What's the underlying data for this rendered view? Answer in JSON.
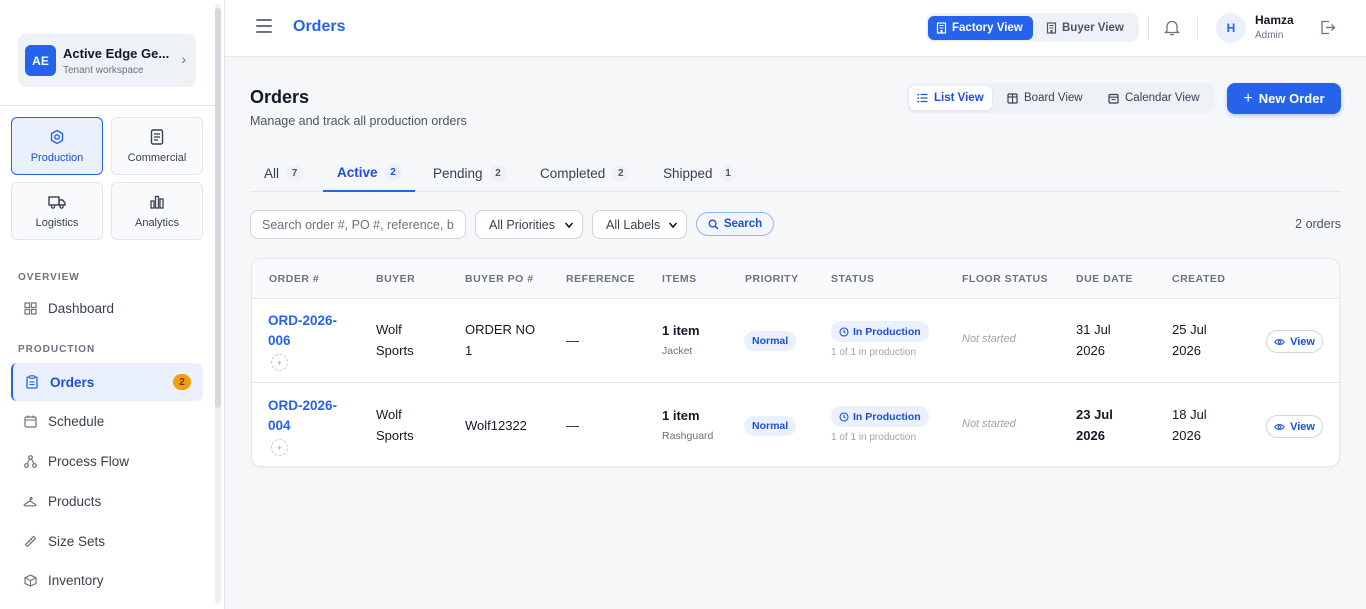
{
  "tenant": {
    "initials": "AE",
    "name": "Active Edge Ge...",
    "subtitle": "Tenant workspace"
  },
  "modules": [
    {
      "label": "Production",
      "icon": "hexagon-icon"
    },
    {
      "label": "Commercial",
      "icon": "document-icon"
    },
    {
      "label": "Logistics",
      "icon": "truck-icon"
    },
    {
      "label": "Analytics",
      "icon": "bar-chart-icon"
    }
  ],
  "sidebar": {
    "overview_label": "OVERVIEW",
    "production_label": "PRODUCTION",
    "items": [
      {
        "label": "Dashboard",
        "icon": "grid-icon"
      },
      {
        "label": "Orders",
        "icon": "clipboard-icon",
        "badge": "2"
      },
      {
        "label": "Schedule",
        "icon": "calendar-icon"
      },
      {
        "label": "Process Flow",
        "icon": "flow-icon"
      },
      {
        "label": "Products",
        "icon": "hanger-icon"
      },
      {
        "label": "Size Sets",
        "icon": "ruler-icon"
      },
      {
        "label": "Inventory",
        "icon": "box-icon"
      }
    ]
  },
  "topbar": {
    "title": "Orders",
    "factory_view": "Factory View",
    "buyer_view": "Buyer View",
    "user_initial": "H",
    "user_name": "Hamza",
    "user_role": "Admin"
  },
  "page": {
    "title": "Orders",
    "subtitle": "Manage and track all production orders",
    "list_view": "List View",
    "board_view": "Board View",
    "calendar_view": "Calendar View",
    "new_order": "New Order"
  },
  "tabs": [
    {
      "label": "All",
      "count": "7"
    },
    {
      "label": "Active",
      "count": "2"
    },
    {
      "label": "Pending",
      "count": "2"
    },
    {
      "label": "Completed",
      "count": "2"
    },
    {
      "label": "Shipped",
      "count": "1"
    }
  ],
  "filters": {
    "search_placeholder": "Search order #, PO #, reference, buyer...",
    "priority": "All Priorities",
    "labels": "All Labels",
    "search_button": "Search",
    "result_count": "2 orders"
  },
  "table": {
    "headers": [
      "ORDER #",
      "BUYER",
      "BUYER PO #",
      "REFERENCE",
      "ITEMS",
      "PRIORITY",
      "STATUS",
      "FLOOR STATUS",
      "DUE DATE",
      "CREATED"
    ],
    "rows": [
      {
        "order": "ORD-2026-006",
        "buyer": "Wolf Sports",
        "po": "ORDER NO 1",
        "reference": "—",
        "items": "1 item",
        "item_type": "Jacket",
        "priority": "Normal",
        "status": "In Production",
        "status_sub": "1 of 1 in production",
        "floor": "Not started",
        "due": "31 Jul 2026",
        "created": "25 Jul 2026",
        "action": "View"
      },
      {
        "order": "ORD-2026-004",
        "buyer": "Wolf Sports",
        "po": "Wolf12322",
        "reference": "—",
        "items": "1 item",
        "item_type": "Rashguard",
        "priority": "Normal",
        "status": "In Production",
        "status_sub": "1 of 1 in production",
        "floor": "Not started",
        "due": "23 Jul 2026",
        "created": "18 Jul 2026",
        "action": "View"
      }
    ]
  },
  "colors": {
    "accent": "#2563eb",
    "badge": "#f59e0b",
    "accent_light": "#eaf1fd"
  }
}
